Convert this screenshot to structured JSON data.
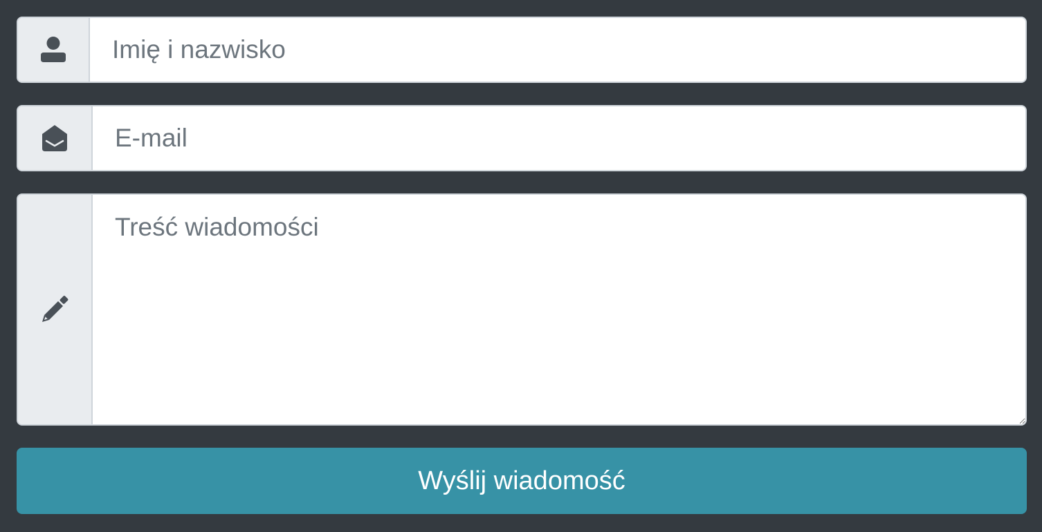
{
  "form": {
    "name": {
      "icon": "user-icon",
      "placeholder": "Imię i nazwisko",
      "value": ""
    },
    "email": {
      "icon": "envelope-open-icon",
      "placeholder": "E-mail",
      "value": ""
    },
    "message": {
      "icon": "pencil-icon",
      "placeholder": "Treść wiadomości",
      "value": ""
    },
    "submit_label": "Wyślij wiadomość"
  },
  "colors": {
    "background": "#343a40",
    "addon_background": "#e9ecef",
    "border": "#ced4da",
    "icon": "#495057",
    "placeholder": "#6c757d",
    "button": "#3792a6",
    "button_text": "#ffffff"
  }
}
